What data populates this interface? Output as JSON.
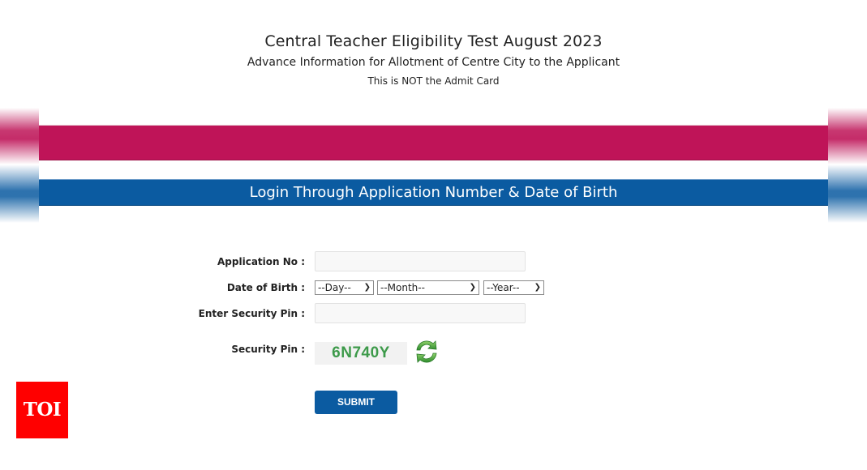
{
  "header": {
    "title": "Central Teacher Eligibility Test August 2023",
    "subtitle": "Advance Information for Allotment of Centre City to the Applicant",
    "note": "This is NOT the Admit Card"
  },
  "colors": {
    "pink_band": "#bf1458",
    "blue_band": "#0b5ba1",
    "captcha_text": "#3d9a4a",
    "logo_bg": "#ff0000"
  },
  "login_banner": "Login Through Application Number & Date of Birth",
  "form": {
    "application_no": {
      "label": "Application No :",
      "value": "",
      "placeholder": ""
    },
    "dob": {
      "label": "Date of Birth :",
      "day": {
        "selected": "--Day--"
      },
      "month": {
        "selected": "--Month--"
      },
      "year": {
        "selected": "--Year--"
      }
    },
    "enter_security_pin": {
      "label": "Enter Security Pin :",
      "value": "",
      "placeholder": ""
    },
    "security_pin": {
      "label": "Security Pin :",
      "captcha": "6N740Y",
      "refresh_icon": "refresh-icon"
    },
    "submit_label": "SUBMIT"
  },
  "watermark": {
    "logo_text": "TOI"
  }
}
